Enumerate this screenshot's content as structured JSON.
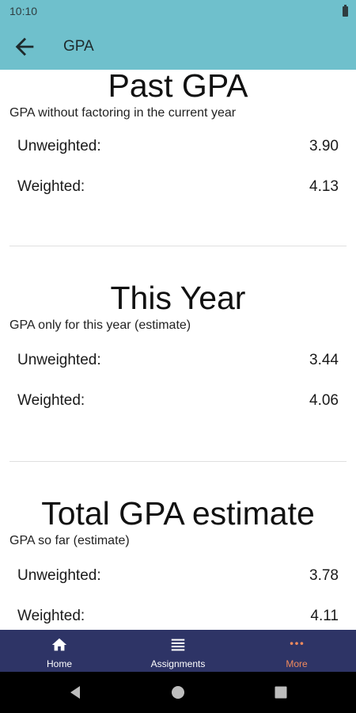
{
  "status_bar": {
    "time": "10:10"
  },
  "app_bar": {
    "title": "GPA"
  },
  "sections": [
    {
      "title": "Past GPA",
      "subtitle": "GPA without factoring in the current year",
      "rows": [
        {
          "label": "Unweighted:",
          "value": "3.90"
        },
        {
          "label": "Weighted:",
          "value": "4.13"
        }
      ]
    },
    {
      "title": "This Year",
      "subtitle": "GPA only for this year (estimate)",
      "rows": [
        {
          "label": "Unweighted:",
          "value": "3.44"
        },
        {
          "label": "Weighted:",
          "value": "4.06"
        }
      ]
    },
    {
      "title": "Total GPA estimate",
      "subtitle": "GPA so far (estimate)",
      "rows": [
        {
          "label": "Unweighted:",
          "value": "3.78"
        },
        {
          "label": "Weighted:",
          "value": "4.11"
        }
      ]
    }
  ],
  "bottom_nav": {
    "items": [
      {
        "label": "Home",
        "icon": "home-icon",
        "active": false
      },
      {
        "label": "Assignments",
        "icon": "list-icon",
        "active": false
      },
      {
        "label": "More",
        "icon": "more-horizontal-icon",
        "active": true
      }
    ],
    "active_color": "#f08a5d",
    "background": "#2e3466"
  },
  "colors": {
    "app_bar": "#6fc0cc"
  }
}
